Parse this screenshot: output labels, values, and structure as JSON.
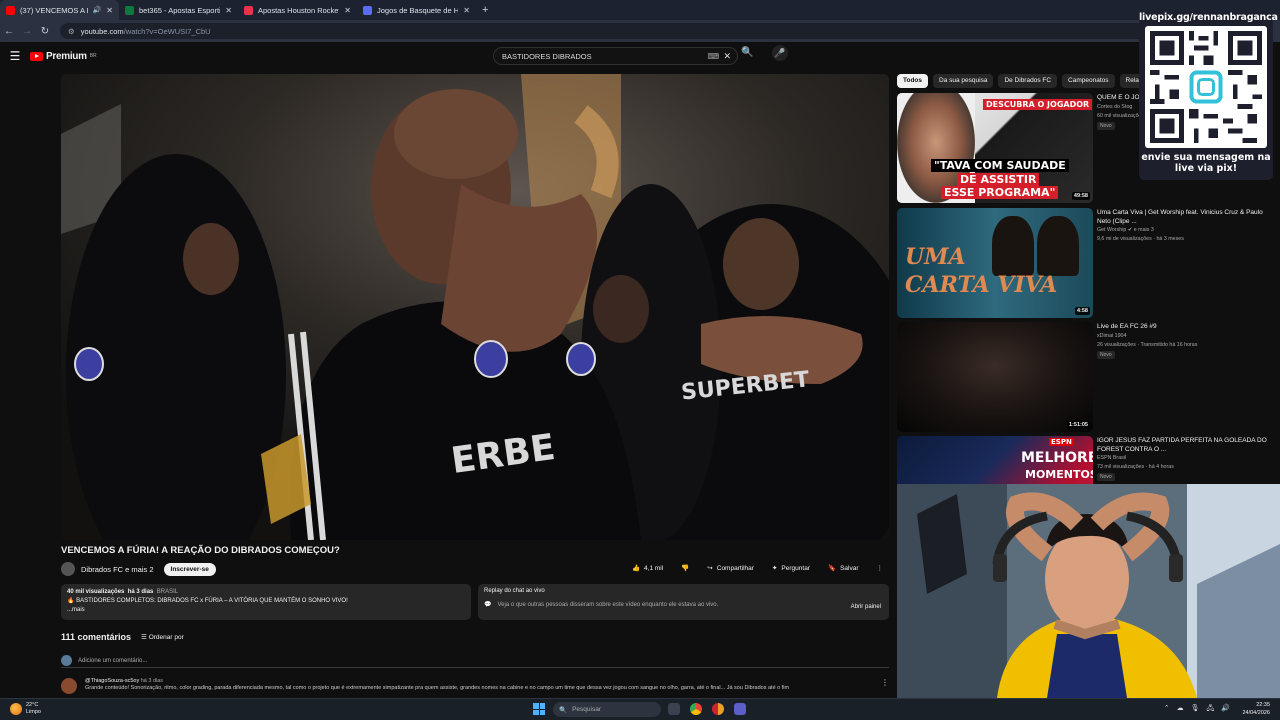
{
  "browser": {
    "tabs": [
      {
        "label": "(37) VENCEMOS A FÚRIA! A",
        "favicon_color": "#ff0000",
        "active": true
      },
      {
        "label": "bet365 - Apostas Esportivas Ol",
        "favicon_color": "#0b7a3e",
        "active": false
      },
      {
        "label": "Apostas Houston Rockets x Los",
        "favicon_color": "#e8334a",
        "active": false
      },
      {
        "label": "Jogos de Basquete de Hoje e F",
        "favicon_color": "#5b6cf0",
        "active": false
      }
    ],
    "new_tab": "+",
    "url_host": "youtube.com",
    "url_path": "/watch?v=OeWUSI7_CbU"
  },
  "header": {
    "logo_text": "Premium",
    "logo_sup": "BR",
    "search_value": "BASTIDORES DIBRADOS"
  },
  "video": {
    "title": "VENCEMOS A FÚRIA! A REAÇÃO DO DIBRADOS COMEÇOU?",
    "jersey_text_1": "SUPERBET",
    "jersey_text_2": "ERBE",
    "channel": "Dibrados FC e mais 2",
    "subscribe": "Inscrever-se",
    "likes": "4,1 mil",
    "share": "Compartilhar",
    "ask": "Perguntar",
    "save": "Salvar",
    "more": "⋮"
  },
  "description": {
    "views": "40 mil visualizações",
    "age": "há 3 dias",
    "location": "BRASIL",
    "line": "BASTIDORES COMPLETOS: DIBRADOS FC x FÚRIA – A VITÓRIA QUE MANTÉM O SONHO VIVO!",
    "more": "...mais"
  },
  "chat_replay": {
    "title": "Replay do chat ao vivo",
    "subtitle": "Veja o que outras pessoas disseram sobre este vídeo enquanto ele estava ao vivo.",
    "open": "Abrir painel"
  },
  "comments": {
    "count": "111 comentários",
    "sort": "Ordenar por",
    "add_placeholder": "Adicione um comentário...",
    "first": {
      "author": "@ThiagoSouza-sc5oy",
      "when": "há 3 dias",
      "text": "Grande conteúdo! Sonorização, ritmo, color grading, parada diferenciada mesmo, tal como o projeto que é extremamente simpatizante pra quem assiste, grandes nomes na cabine e no campo um time que dessa vez jogou com sangue no olho, garra, até o final... Já sou Dibrados até o fim"
    }
  },
  "chips": [
    "Todos",
    "Da sua pesquisa",
    "De Dibrados FC",
    "Campeonatos",
    "Relacionad"
  ],
  "recommendations": [
    {
      "title": "QUEM É O JOGADOR? FT. CAIO RIBEIRO",
      "channel": "Cortes do Stog",
      "meta": "60 mil visualizações",
      "badge": "Novo",
      "duration": "49:58",
      "thumb_line1": "DESCUBRA O JOGADOR",
      "thumb_line2": "\"TAVA COM SAUDADE",
      "thumb_line3": "DE ASSISTIR",
      "thumb_line4": "ESSE PROGRAMA\""
    },
    {
      "title": "Uma Carta Viva | Get Worship feat. Vinicius Cruz & Paulo Neto (Clipe ...",
      "channel": "Get Worship",
      "channel_extra": "e mais 3",
      "meta": "9,6 mi de visualizações · há 3 meses",
      "badge": "",
      "duration": "4:58",
      "thumb_line1": "UMA",
      "thumb_line2": "CARTA VIVA"
    },
    {
      "title": "Live de EA FC 26 #9",
      "channel": "xDimai 1904",
      "meta": "26 visualizações · Transmitido há 16 horas",
      "badge": "Novo",
      "duration": "1:51:05"
    },
    {
      "title": "IGOR JESUS FAZ PARTIDA PERFEITA NA GOLEADA DO FOREST CONTRA O ...",
      "channel": "ESPN Brasil",
      "meta": "73 mil visualizações · há 4 horas",
      "badge": "Novo",
      "thumb_brand": "ESPN",
      "thumb_line1": "MELHORES",
      "thumb_line2": "MOMENTOS"
    }
  ],
  "overlay": {
    "pix_url": "livepix.gg/rennanbraganca",
    "caption_1": "envie sua mensagem na",
    "caption_2": "live via pix!"
  },
  "taskbar": {
    "temp": "22°C",
    "condition": "Limpo",
    "search": "Pesquisar",
    "time": "22:35",
    "date": "24/04/2026"
  },
  "colors": {
    "youtube_red": "#ff0000",
    "bg": "#0f0f0f",
    "chrome_bar": "#2b3140"
  }
}
